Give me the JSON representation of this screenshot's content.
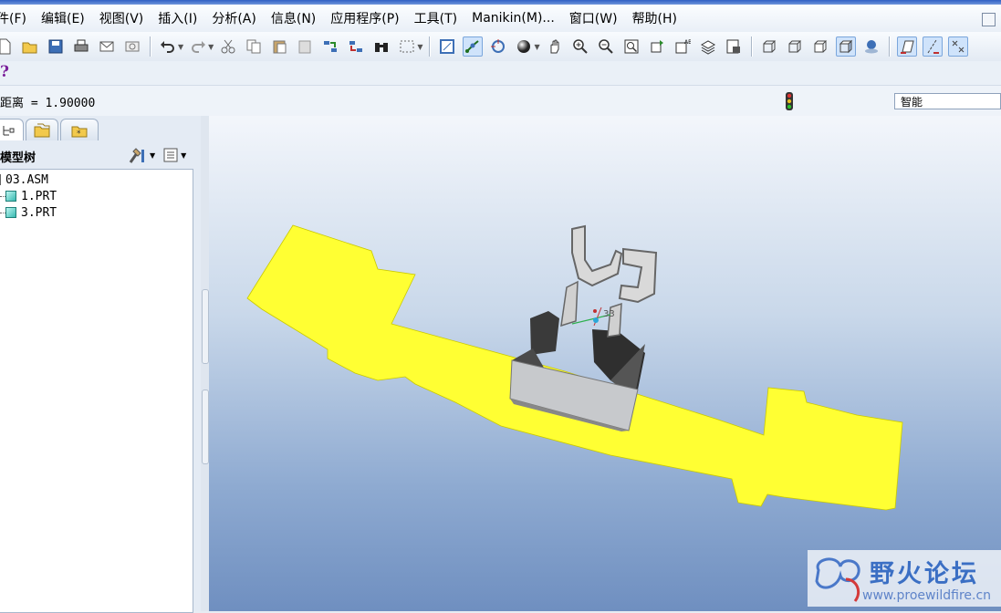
{
  "menubar": {
    "items": [
      "件(F)",
      "编辑(E)",
      "视图(V)",
      "插入(I)",
      "分析(A)",
      "信息(N)",
      "应用程序(P)",
      "工具(T)",
      "Manikin(M)...",
      "窗口(W)",
      "帮助(H)"
    ]
  },
  "help": {
    "label": "?"
  },
  "message": {
    "text": "距离 = 1.90000"
  },
  "filter": {
    "value": "智能"
  },
  "navigator": {
    "title": "模型树",
    "items": [
      {
        "label": "03.ASM"
      },
      {
        "label": "1.PRT"
      },
      {
        "label": "3.PRT"
      }
    ]
  },
  "viewport": {
    "dimension_label": "33",
    "colors": {
      "part_yellow": "#ffff33",
      "clip": "#9ea3a8"
    }
  },
  "watermark": {
    "title": "野火论坛",
    "url": "www.proewildfire.cn"
  }
}
